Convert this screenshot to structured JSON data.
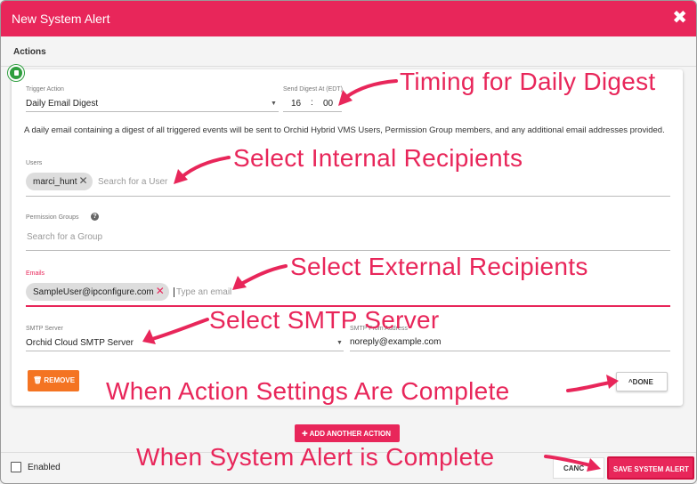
{
  "dialog": {
    "title": "New System Alert",
    "close_symbol": "✖",
    "section": "Actions"
  },
  "action": {
    "trigger_label": "Trigger Action",
    "trigger_value": "Daily Email Digest",
    "send_label": "Send Digest At (EDT)",
    "send_hour": "16",
    "send_sep": ":",
    "send_minute": "00",
    "description": "A daily email containing a digest of all triggered events will be sent to Orchid Hybrid VMS Users, Permission Group members, and any additional email addresses provided.",
    "users_label": "Users",
    "user_chip": "marci_hunt",
    "users_placeholder": "Search for a User",
    "groups_label": "Permission Groups",
    "groups_placeholder": "Search for a Group",
    "help_symbol": "?",
    "emails_label": "Emails",
    "email_chip": "SampleUser@ipconfigure.com",
    "email_placeholder": "Type an email",
    "smtp_label": "SMTP Server",
    "smtp_value": "Orchid Cloud SMTP Server",
    "from_label": "SMTP From Address *",
    "from_value": "noreply@example.com",
    "remove_label": "REMOVE",
    "done_label": "DONE",
    "chip_close": "✕"
  },
  "footer": {
    "add_action_label": "ADD ANOTHER ACTION",
    "enabled_label": "Enabled",
    "cancel_label": "CANC",
    "save_label": "SAVE SYSTEM ALERT"
  },
  "annotations": {
    "timing": "Timing for Daily Digest",
    "internal": "Select Internal Recipients",
    "external": "Select External Recipients",
    "smtp": "Select SMTP Server",
    "action_done": "When Action Settings Are  Complete",
    "alert_done": "When System Alert is  Complete"
  },
  "colors": {
    "accent": "#e8265a",
    "remove": "#f47422",
    "badge": "#2e9e3e"
  }
}
